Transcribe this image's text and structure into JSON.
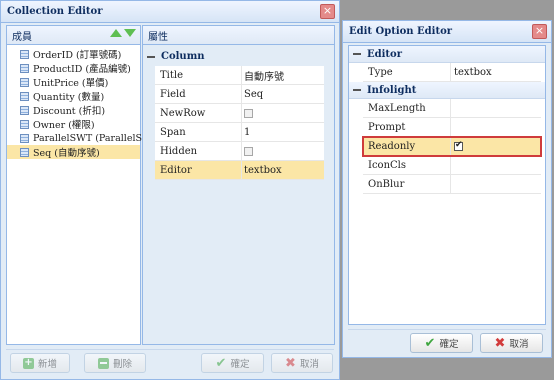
{
  "collection_editor": {
    "title": "Collection Editor",
    "members_header": "成員",
    "properties_header": "屬性",
    "members": [
      {
        "label": "OrderID (訂單號碼)",
        "selected": false
      },
      {
        "label": "ProductID (產品編號)",
        "selected": false
      },
      {
        "label": "UnitPrice (單價)",
        "selected": false
      },
      {
        "label": "Quantity (數量)",
        "selected": false
      },
      {
        "label": "Discount (折扣)",
        "selected": false
      },
      {
        "label": "Owner (權限)",
        "selected": false
      },
      {
        "label": "ParallelSWT (ParallelSWT)",
        "selected": false
      },
      {
        "label": "Seq (自動序號)",
        "selected": true
      }
    ],
    "group": "Column",
    "properties": [
      {
        "key": "Title",
        "value": "自動序號"
      },
      {
        "key": "Field",
        "value": "Seq"
      },
      {
        "key": "NewRow",
        "value": ""
      },
      {
        "key": "Span",
        "value": "1"
      },
      {
        "key": "Hidden",
        "value": ""
      },
      {
        "key": "Editor",
        "value": "textbox"
      }
    ],
    "buttons": {
      "add": "新增",
      "delete": "刪除",
      "ok": "確定",
      "cancel": "取消"
    }
  },
  "edit_option_editor": {
    "title": "Edit Option Editor",
    "group_editor": "Editor",
    "type_key": "Type",
    "type_value": "textbox",
    "group_infolight": "Infolight",
    "rows": [
      "MaxLength",
      "Prompt",
      "Readonly",
      "IconCls",
      "OnBlur"
    ],
    "readonly_checked": true,
    "buttons": {
      "ok": "確定",
      "cancel": "取消"
    }
  },
  "icons": {
    "close": "close-icon",
    "up": "arrow-up-icon",
    "down": "arrow-down-icon",
    "member": "table-icon",
    "add": "plus-icon",
    "delete": "minus-icon",
    "ok": "check-icon",
    "cancel": "x-icon"
  },
  "colors": {
    "accent": "#95b8e7",
    "selection": "#fbe6a6",
    "highlight_border": "#cf3b3b",
    "green": "#4eae4a"
  }
}
